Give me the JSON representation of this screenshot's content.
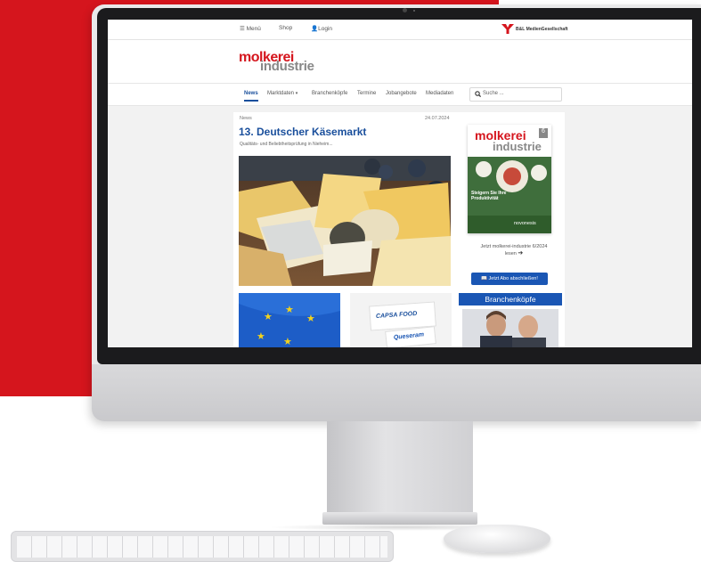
{
  "topbar": {
    "menu_label": "Menü",
    "shop_label": "Shop",
    "login_label": "Login",
    "publisher": "B&L MedienGesellschaft"
  },
  "brand": {
    "line1": "molkerei",
    "line2": "industrie",
    "accent": "#d5151d",
    "primary_blue": "#1a4f9c"
  },
  "nav": {
    "items": [
      "News",
      "Marktdaten",
      "Branchenköpfe",
      "Termine",
      "Jobangebote",
      "Mediadaten"
    ],
    "active": "News",
    "search_placeholder": "Suche ..."
  },
  "article": {
    "category": "News",
    "date": "24.07.2024",
    "title": "13. Deutscher Käsemarkt",
    "subtitle": "Qualitäts- und Beliebtheitsprüfung in Nieheim..."
  },
  "thumbs": {
    "capsa_brand": "CAPSA FOOD",
    "capsa_sub": "Queseram"
  },
  "sidebar": {
    "magazine_title_1": "molkerei",
    "magazine_title_2": "industrie",
    "magazine_issue": "6",
    "magazine_headline": "Steigern Sie Ihre Produktivität",
    "magazine_sponsor": "novonesis",
    "read_label": "Jetzt molkerei-industrie 6/2024 lesen",
    "subscribe_label": "Jetzt Abo abschließen!",
    "branchenkoepfe_title": "Branchenköpfe"
  }
}
